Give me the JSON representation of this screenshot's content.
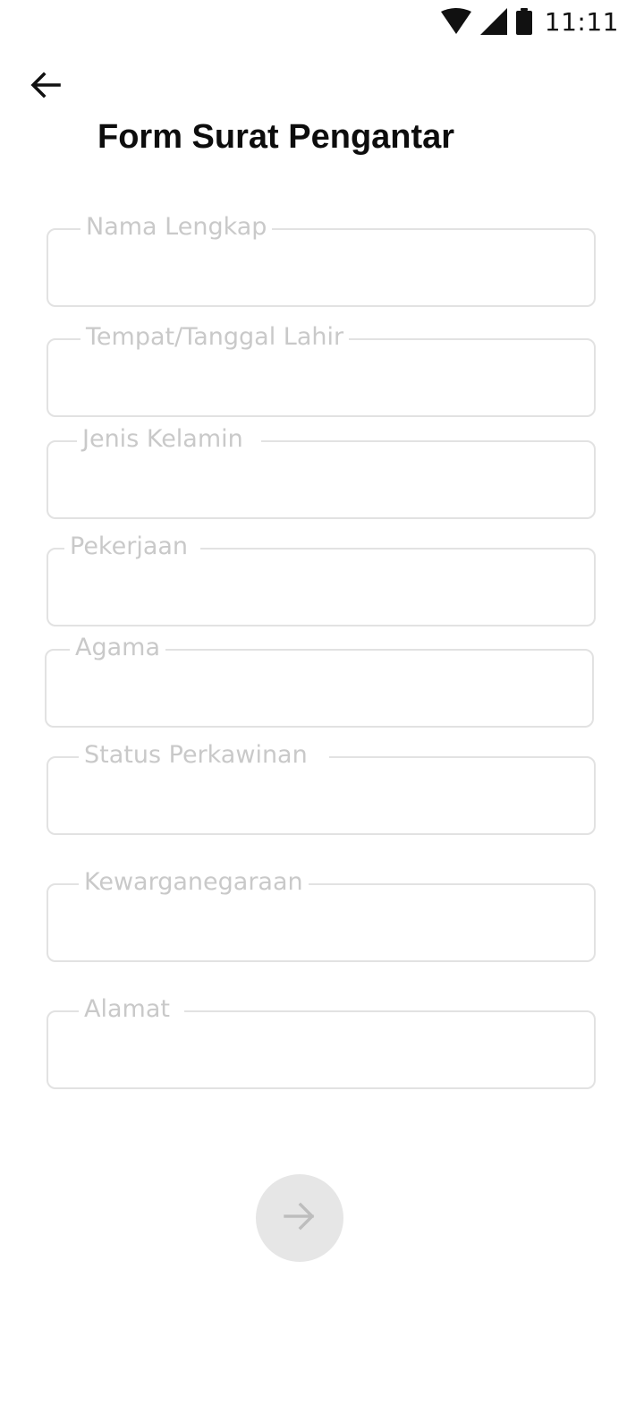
{
  "status_bar": {
    "time": "11:11",
    "icons": [
      "wifi-icon",
      "cellular-signal-icon",
      "battery-icon"
    ]
  },
  "header": {
    "back_icon": "arrow-left-icon",
    "title": "Form Surat Pengantar"
  },
  "form": {
    "fields": [
      {
        "label": "Nama Lengkap",
        "value": ""
      },
      {
        "label": "Tempat/Tanggal Lahir",
        "value": ""
      },
      {
        "label": "Jenis Kelamin",
        "value": ""
      },
      {
        "label": "Pekerjaan",
        "value": ""
      },
      {
        "label": "Agama",
        "value": ""
      },
      {
        "label": "Status Perkawinan",
        "value": ""
      },
      {
        "label": "Kewarganegaraan",
        "value": ""
      },
      {
        "label": "Alamat",
        "value": ""
      }
    ]
  },
  "actions": {
    "next_icon": "arrow-right-icon"
  },
  "colors": {
    "field_border": "#e2e2e2",
    "label_text": "#c9c9c9",
    "next_button_bg": "#e6e6e6",
    "next_arrow": "#bdbdbd",
    "title_text": "#0d0d0d"
  }
}
